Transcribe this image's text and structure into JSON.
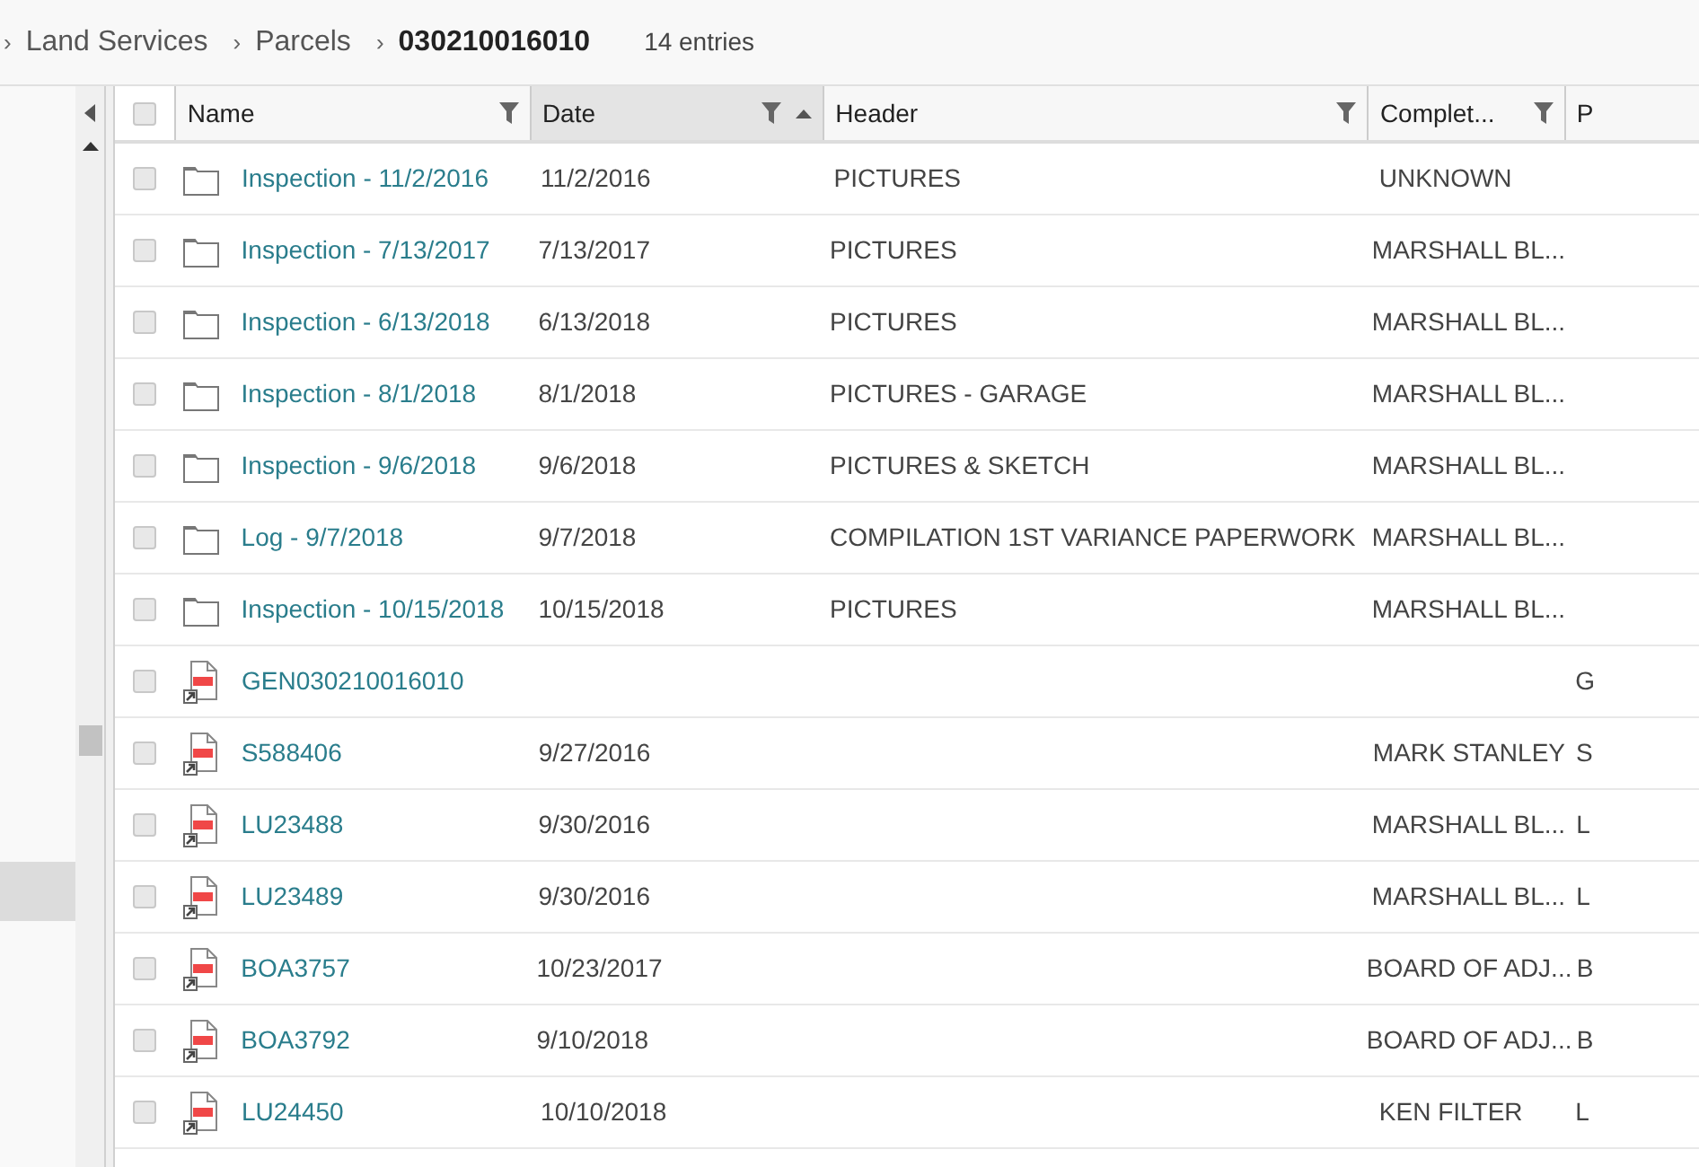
{
  "breadcrumb": {
    "items": [
      {
        "separator": "›",
        "label": "Land Services",
        "current": false
      },
      {
        "separator": "›",
        "label": "Parcels",
        "current": false
      },
      {
        "separator": "›",
        "label": "030210016010",
        "current": true
      }
    ],
    "count": "14 entries"
  },
  "table": {
    "all_checked": false,
    "columns": [
      {
        "label": "Name",
        "filter": true,
        "sorted": false
      },
      {
        "label": "Date",
        "filter": true,
        "sorted": true
      },
      {
        "label": "Header",
        "filter": true,
        "sorted": false
      },
      {
        "label": "Complet...",
        "filter": true,
        "sorted": false
      },
      {
        "label": "P",
        "filter": false,
        "sorted": false
      }
    ],
    "rows": [
      {
        "kind": "folder",
        "checked": false,
        "name": "Inspection - 11/2/2016",
        "date": "11/2/2016",
        "header": "PICTURES",
        "completed": "UNKNOWN"
      },
      {
        "kind": "folder",
        "checked": false,
        "name": "Inspection - 7/13/2017",
        "date": "7/13/2017",
        "header": "PICTURES",
        "completed": "MARSHALL BL..."
      },
      {
        "kind": "folder",
        "checked": false,
        "name": "Inspection - 6/13/2018",
        "date": "6/13/2018",
        "header": "PICTURES",
        "completed": "MARSHALL BL..."
      },
      {
        "kind": "folder",
        "checked": false,
        "name": "Inspection - 8/1/2018",
        "date": "8/1/2018",
        "header": "PICTURES - GARAGE",
        "completed": "MARSHALL BL..."
      },
      {
        "kind": "folder",
        "checked": false,
        "name": "Inspection - 9/6/2018",
        "date": "9/6/2018",
        "header": "PICTURES & SKETCH",
        "completed": "MARSHALL BL..."
      },
      {
        "kind": "folder",
        "checked": false,
        "name": "Log - 9/7/2018",
        "date": "9/7/2018",
        "header": "COMPILATION 1ST VARIANCE PAPERWORK",
        "completed": "MARSHALL BL..."
      },
      {
        "kind": "folder",
        "checked": false,
        "name": "Inspection - 10/15/2018",
        "date": "10/15/2018",
        "header": "PICTURES",
        "completed": "MARSHALL BL..."
      },
      {
        "kind": "pdf",
        "checked": false,
        "name": "GEN030210016010",
        "column_5": "G"
      },
      {
        "kind": "pdf",
        "checked": false,
        "name": "S588406",
        "date": "9/27/2016",
        "completed": "MARK STANLEY",
        "column_5": "S"
      },
      {
        "kind": "pdf",
        "checked": false,
        "name": "LU23488",
        "date": "9/30/2016",
        "completed": "MARSHALL BL...",
        "column_5": "L"
      },
      {
        "kind": "pdf",
        "checked": false,
        "name": "LU23489",
        "date": "9/30/2016",
        "completed": "MARSHALL BL...",
        "column_5": "L"
      },
      {
        "kind": "pdf",
        "checked": false,
        "name": "BOA3757",
        "date": "10/23/2017",
        "completed": "BOARD OF ADJ...",
        "column_5": "B"
      },
      {
        "kind": "pdf",
        "checked": false,
        "name": "BOA3792",
        "date": "9/10/2018",
        "completed": "BOARD OF ADJ...",
        "column_5": "B"
      },
      {
        "kind": "pdf",
        "checked": false,
        "name": "LU24450",
        "date": "10/10/2018",
        "completed": "KEN FILTER",
        "column_5": "L"
      }
    ]
  }
}
